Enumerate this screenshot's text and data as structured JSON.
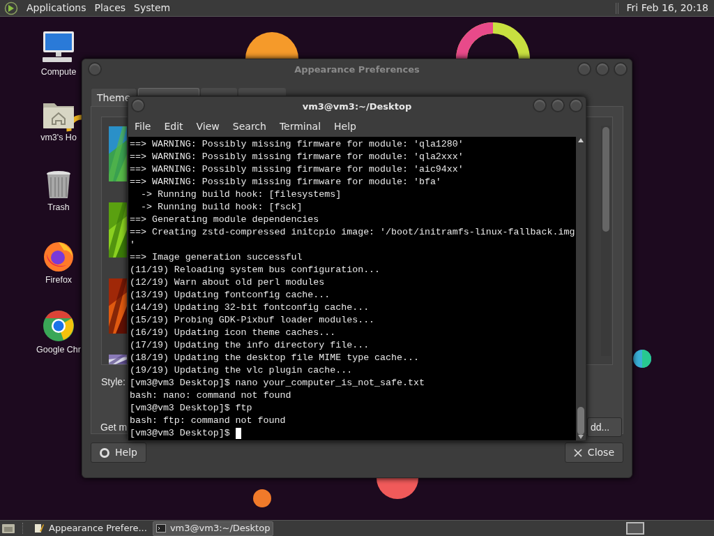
{
  "top_panel": {
    "menus": [
      "Applications",
      "Places",
      "System"
    ],
    "clock": "Fri Feb 16, 20:18"
  },
  "desktop_icons": [
    {
      "label": "Compute",
      "kind": "computer"
    },
    {
      "label": "vm3's Ho",
      "kind": "home"
    },
    {
      "label": "Trash",
      "kind": "trash"
    },
    {
      "label": "Firefox",
      "kind": "firefox"
    },
    {
      "label": "Google Chr",
      "kind": "chrome"
    }
  ],
  "appearance_window": {
    "title": "Appearance Preferences",
    "tabs": [
      {
        "label": "Theme",
        "selected": false
      }
    ],
    "style_label": "Style:",
    "get_more_label": "Get m",
    "add_button": "dd...",
    "help_button": "Help",
    "close_button": "Close"
  },
  "terminal": {
    "title": "vm3@vm3:~/Desktop",
    "menus": [
      "File",
      "Edit",
      "View",
      "Search",
      "Terminal",
      "Help"
    ],
    "lines": [
      "==> WARNING: Possibly missing firmware for module: 'qla1280'",
      "==> WARNING: Possibly missing firmware for module: 'qla2xxx'",
      "==> WARNING: Possibly missing firmware for module: 'aic94xx'",
      "==> WARNING: Possibly missing firmware for module: 'bfa'",
      "  -> Running build hook: [filesystems]",
      "  -> Running build hook: [fsck]",
      "==> Generating module dependencies",
      "==> Creating zstd-compressed initcpio image: '/boot/initramfs-linux-fallback.img",
      "'",
      "==> Image generation successful",
      "(11/19) Reloading system bus configuration...",
      "(12/19) Warn about old perl modules",
      "(13/19) Updating fontconfig cache...",
      "(14/19) Updating 32-bit fontconfig cache...",
      "(15/19) Probing GDK-Pixbuf loader modules...",
      "(16/19) Updating icon theme caches...",
      "(17/19) Updating the info directory file...",
      "(18/19) Updating the desktop file MIME type cache...",
      "(19/19) Updating the vlc plugin cache...",
      "[vm3@vm3 Desktop]$ nano your_computer_is_not_safe.txt",
      "bash: nano: command not found",
      "[vm3@vm3 Desktop]$ ftp",
      "bash: ftp: command not found",
      "[vm3@vm3 Desktop]$ "
    ]
  },
  "taskbar": {
    "items": [
      {
        "label": "Appearance Prefere...",
        "kind": "appearance",
        "selected": false
      },
      {
        "label": "vm3@vm3:~/Desktop",
        "kind": "terminal",
        "selected": true
      }
    ]
  }
}
